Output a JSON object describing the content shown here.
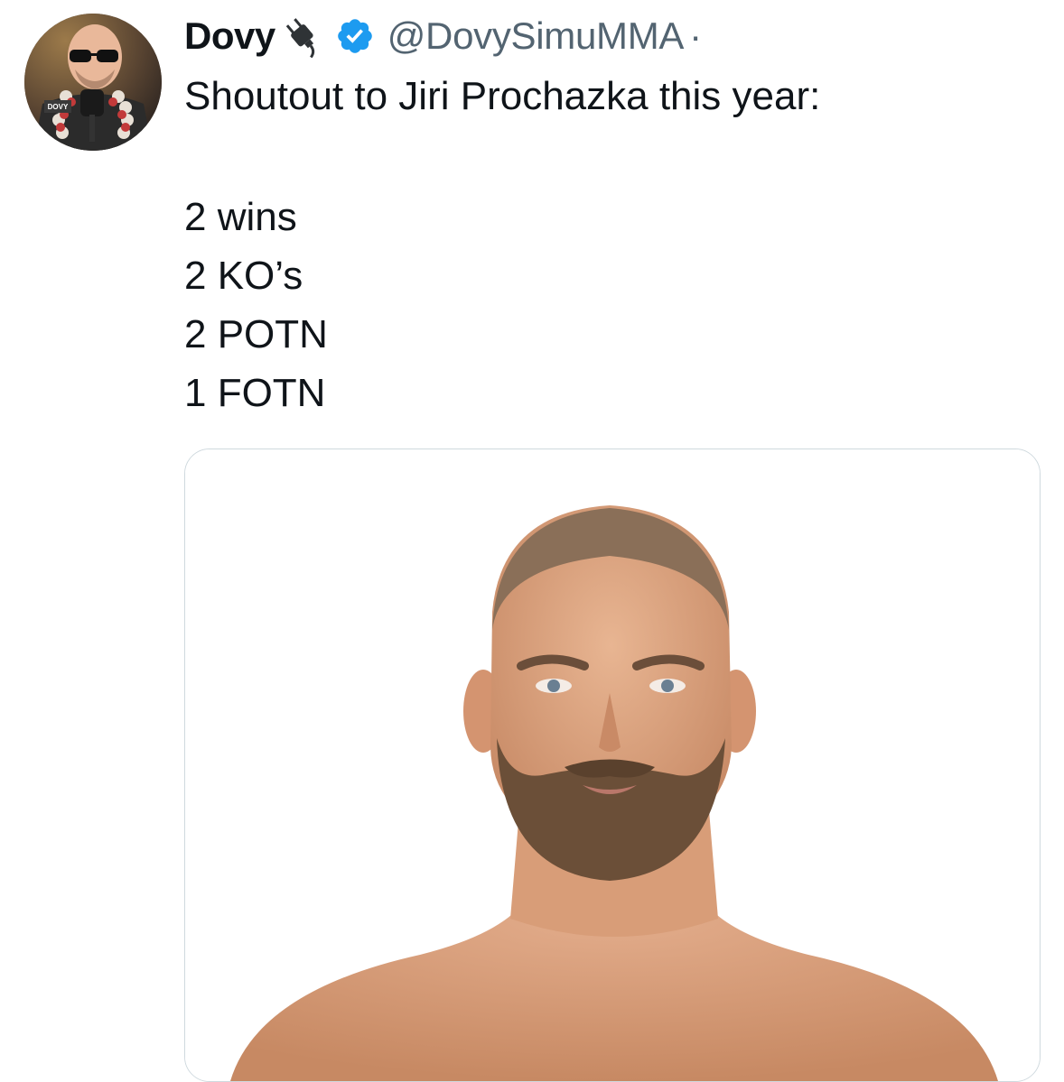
{
  "tweet": {
    "display_name": "Dovy",
    "display_name_emoji": "plug-emoji",
    "verified_badge": "verified-check-icon",
    "handle": "@DovySimuMMA",
    "separator": "·",
    "lines": [
      "Shoutout to Jiri Prochazka this year:",
      "2 wins",
      "2 KO’s",
      "2 POTN",
      "1 FOTN"
    ],
    "avatar_text": "DOVY"
  },
  "colors": {
    "verified_blue": "#1d9bf0",
    "handle_gray": "#536471",
    "text": "#0f1419"
  }
}
